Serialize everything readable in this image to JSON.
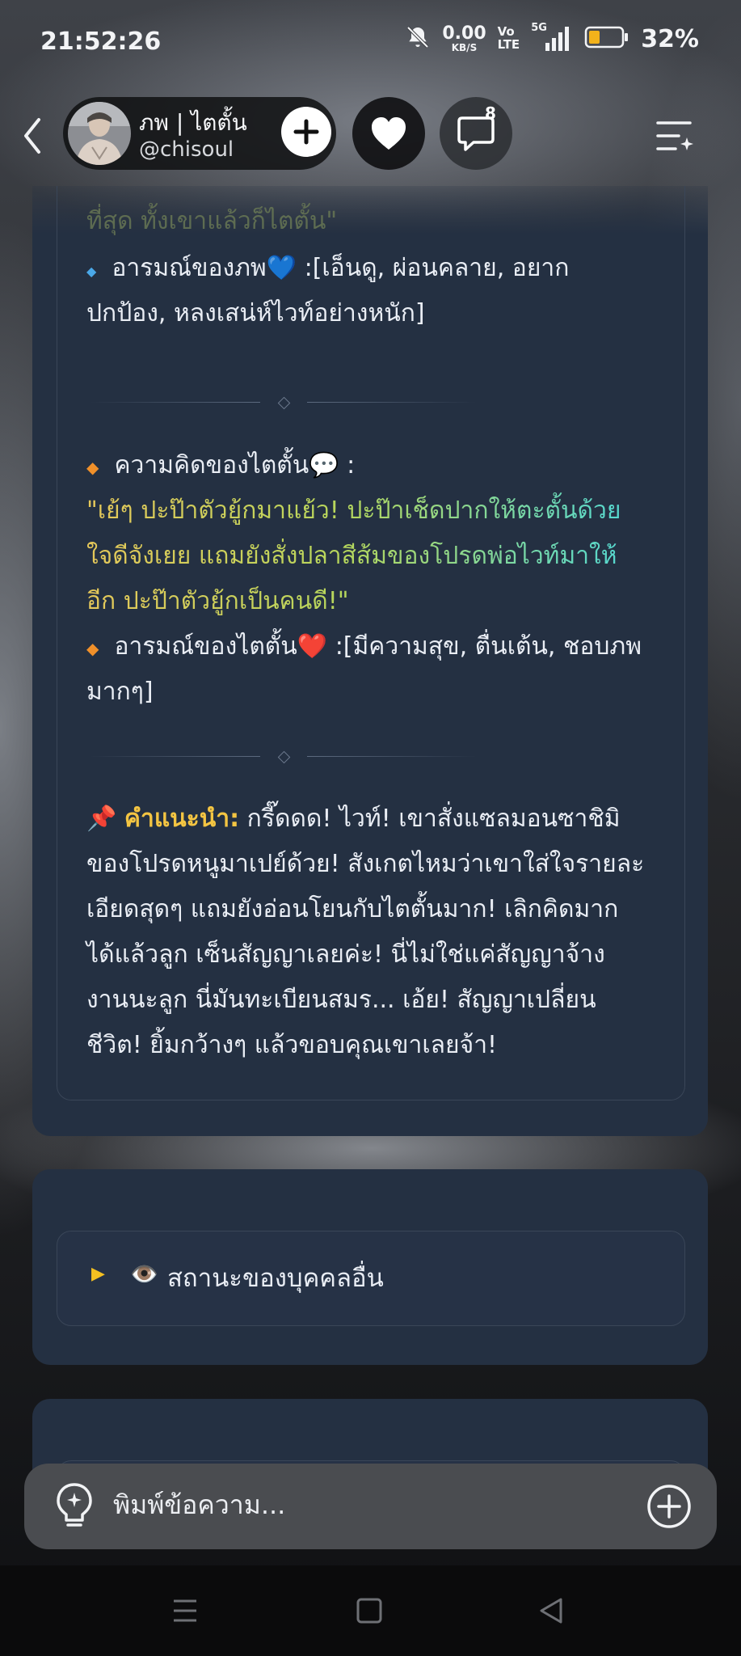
{
  "status_bar": {
    "time": "21:52:26",
    "net_speed": "0.00",
    "net_unit": "KB/S",
    "volte_top": "Vo",
    "volte_bottom": "LTE",
    "network": "5G",
    "battery": "32%",
    "battery_level": 0.32,
    "icons": [
      "bell-muted-icon",
      "signal-icon",
      "battery-icon"
    ]
  },
  "header": {
    "character_name": "ภพ | ไตตั้น",
    "handle": "@chisoul",
    "comment_count": "8",
    "icons": [
      "back-icon",
      "plus-icon",
      "heart-icon",
      "comment-icon",
      "menu-icon"
    ]
  },
  "card1": {
    "faded_line": "ที่สุด ทั้งเขาแล้วก็ไตตั้น\"",
    "mood_phop_label": "อารมณ์ของภพ💙",
    "mood_phop_value_1": ":[เอ็นดู, ผ่อนคลาย, อยาก",
    "mood_phop_value_2": "ปกป้อง, หลงเสน่ห์ไวท์อย่างหนัก]",
    "thought_label": "ความคิดของไตตั้น💬 :",
    "thought_quote_1": "\"เย้ๆ ปะป๊าตัวยู้กมาแย้ว! ปะป๊าเช็ดปากให้ตะตั้นด้วย",
    "thought_quote_2": "ใจดีจังเยย แถมยังสั่งปลาสีส้มของโปรดพ่อไวท์มาให้",
    "thought_quote_3": "อีก ปะป๊าตัวยู้กเป็นคนดี!\"",
    "mood_taitan_label": "อารมณ์ของไตตั้น❤️",
    "mood_taitan_value_1": ":[มีความสุข, ตื่นเต้น, ชอบภพ",
    "mood_taitan_value_2": "มากๆ]",
    "advice_pin": "📌",
    "advice_label": "คำแนะนำ:",
    "advice_1": " กรี๊ดดด! ไวท์! เขาสั่งแซลมอนซาชิมิ",
    "advice_2": "ของโปรดหนูมาเปย์ด้วย! สังเกตไหมว่าเขาใส่ใจรายละ",
    "advice_3": "เอียดสุดๆ แถมยังอ่อนโยนกับไตตั้นมาก! เลิกคิดมาก",
    "advice_4": "ได้แล้วลูก เซ็นสัญญาเลยค่ะ! นี่ไม่ใช่แค่สัญญาจ้าง",
    "advice_5": "งานนะลูก นี่มันทะเบียนสมร... เอ้ย! สัญญาเปลี่ยน",
    "advice_6": "ชีวิต! ยิ้มกว้างๆ แล้วขอบคุณเขาเลยจ้า!"
  },
  "card2": {
    "arrow": "▶",
    "eye": "👁️",
    "label": "สถานะของบุคคลอื่น"
  },
  "composer": {
    "placeholder": "พิมพ์ข้อความ...",
    "icons": [
      "lightbulb-icon",
      "add-circle-icon"
    ]
  },
  "navbar": {
    "icons": [
      "nav-menu-icon",
      "nav-home-icon",
      "nav-back-icon"
    ]
  }
}
